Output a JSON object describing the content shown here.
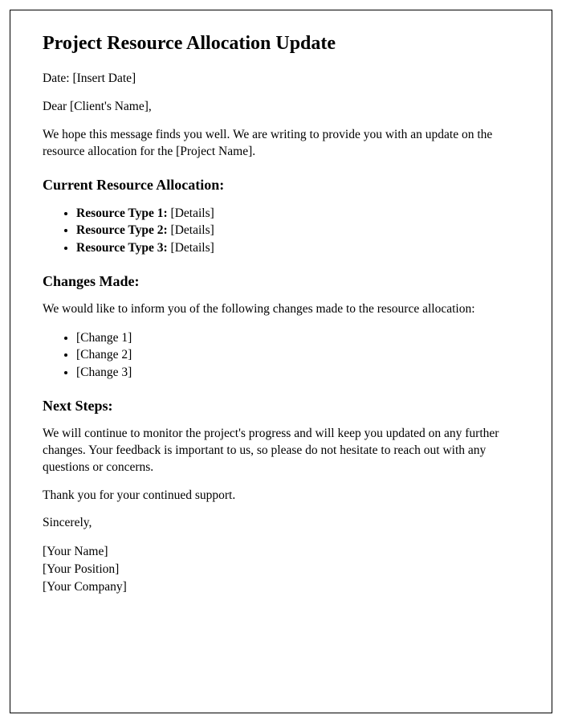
{
  "title": "Project Resource Allocation Update",
  "date_line": "Date: [Insert Date]",
  "salutation": "Dear [Client's Name],",
  "intro": "We hope this message finds you well. We are writing to provide you with an update on the resource allocation for the [Project Name].",
  "sections": {
    "current_allocation": {
      "heading": "Current Resource Allocation:",
      "items": [
        {
          "label": "Resource Type 1:",
          "value": " [Details]"
        },
        {
          "label": "Resource Type 2:",
          "value": " [Details]"
        },
        {
          "label": "Resource Type 3:",
          "value": " [Details]"
        }
      ]
    },
    "changes_made": {
      "heading": "Changes Made:",
      "intro": "We would like to inform you of the following changes made to the resource allocation:",
      "items": [
        "[Change 1]",
        "[Change 2]",
        "[Change 3]"
      ]
    },
    "next_steps": {
      "heading": "Next Steps:",
      "body": "We will continue to monitor the project's progress and will keep you updated on any further changes. Your feedback is important to us, so please do not hesitate to reach out with any questions or concerns."
    }
  },
  "thanks": "Thank you for your continued support.",
  "closing": "Sincerely,",
  "signature": {
    "name": "[Your Name]",
    "position": "[Your Position]",
    "company": "[Your Company]"
  }
}
